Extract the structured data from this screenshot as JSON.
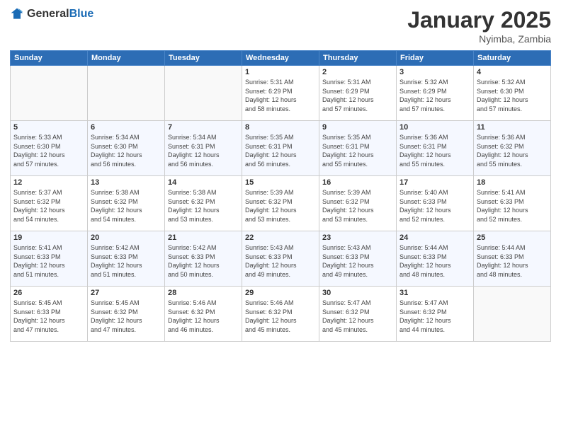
{
  "logo": {
    "general": "General",
    "blue": "Blue"
  },
  "header": {
    "title": "January 2025",
    "subtitle": "Nyimba, Zambia"
  },
  "weekdays": [
    "Sunday",
    "Monday",
    "Tuesday",
    "Wednesday",
    "Thursday",
    "Friday",
    "Saturday"
  ],
  "weeks": [
    [
      {
        "day": "",
        "info": ""
      },
      {
        "day": "",
        "info": ""
      },
      {
        "day": "",
        "info": ""
      },
      {
        "day": "1",
        "info": "Sunrise: 5:31 AM\nSunset: 6:29 PM\nDaylight: 12 hours\nand 58 minutes."
      },
      {
        "day": "2",
        "info": "Sunrise: 5:31 AM\nSunset: 6:29 PM\nDaylight: 12 hours\nand 57 minutes."
      },
      {
        "day": "3",
        "info": "Sunrise: 5:32 AM\nSunset: 6:29 PM\nDaylight: 12 hours\nand 57 minutes."
      },
      {
        "day": "4",
        "info": "Sunrise: 5:32 AM\nSunset: 6:30 PM\nDaylight: 12 hours\nand 57 minutes."
      }
    ],
    [
      {
        "day": "5",
        "info": "Sunrise: 5:33 AM\nSunset: 6:30 PM\nDaylight: 12 hours\nand 57 minutes."
      },
      {
        "day": "6",
        "info": "Sunrise: 5:34 AM\nSunset: 6:30 PM\nDaylight: 12 hours\nand 56 minutes."
      },
      {
        "day": "7",
        "info": "Sunrise: 5:34 AM\nSunset: 6:31 PM\nDaylight: 12 hours\nand 56 minutes."
      },
      {
        "day": "8",
        "info": "Sunrise: 5:35 AM\nSunset: 6:31 PM\nDaylight: 12 hours\nand 56 minutes."
      },
      {
        "day": "9",
        "info": "Sunrise: 5:35 AM\nSunset: 6:31 PM\nDaylight: 12 hours\nand 55 minutes."
      },
      {
        "day": "10",
        "info": "Sunrise: 5:36 AM\nSunset: 6:31 PM\nDaylight: 12 hours\nand 55 minutes."
      },
      {
        "day": "11",
        "info": "Sunrise: 5:36 AM\nSunset: 6:32 PM\nDaylight: 12 hours\nand 55 minutes."
      }
    ],
    [
      {
        "day": "12",
        "info": "Sunrise: 5:37 AM\nSunset: 6:32 PM\nDaylight: 12 hours\nand 54 minutes."
      },
      {
        "day": "13",
        "info": "Sunrise: 5:38 AM\nSunset: 6:32 PM\nDaylight: 12 hours\nand 54 minutes."
      },
      {
        "day": "14",
        "info": "Sunrise: 5:38 AM\nSunset: 6:32 PM\nDaylight: 12 hours\nand 53 minutes."
      },
      {
        "day": "15",
        "info": "Sunrise: 5:39 AM\nSunset: 6:32 PM\nDaylight: 12 hours\nand 53 minutes."
      },
      {
        "day": "16",
        "info": "Sunrise: 5:39 AM\nSunset: 6:32 PM\nDaylight: 12 hours\nand 53 minutes."
      },
      {
        "day": "17",
        "info": "Sunrise: 5:40 AM\nSunset: 6:33 PM\nDaylight: 12 hours\nand 52 minutes."
      },
      {
        "day": "18",
        "info": "Sunrise: 5:41 AM\nSunset: 6:33 PM\nDaylight: 12 hours\nand 52 minutes."
      }
    ],
    [
      {
        "day": "19",
        "info": "Sunrise: 5:41 AM\nSunset: 6:33 PM\nDaylight: 12 hours\nand 51 minutes."
      },
      {
        "day": "20",
        "info": "Sunrise: 5:42 AM\nSunset: 6:33 PM\nDaylight: 12 hours\nand 51 minutes."
      },
      {
        "day": "21",
        "info": "Sunrise: 5:42 AM\nSunset: 6:33 PM\nDaylight: 12 hours\nand 50 minutes."
      },
      {
        "day": "22",
        "info": "Sunrise: 5:43 AM\nSunset: 6:33 PM\nDaylight: 12 hours\nand 49 minutes."
      },
      {
        "day": "23",
        "info": "Sunrise: 5:43 AM\nSunset: 6:33 PM\nDaylight: 12 hours\nand 49 minutes."
      },
      {
        "day": "24",
        "info": "Sunrise: 5:44 AM\nSunset: 6:33 PM\nDaylight: 12 hours\nand 48 minutes."
      },
      {
        "day": "25",
        "info": "Sunrise: 5:44 AM\nSunset: 6:33 PM\nDaylight: 12 hours\nand 48 minutes."
      }
    ],
    [
      {
        "day": "26",
        "info": "Sunrise: 5:45 AM\nSunset: 6:33 PM\nDaylight: 12 hours\nand 47 minutes."
      },
      {
        "day": "27",
        "info": "Sunrise: 5:45 AM\nSunset: 6:32 PM\nDaylight: 12 hours\nand 47 minutes."
      },
      {
        "day": "28",
        "info": "Sunrise: 5:46 AM\nSunset: 6:32 PM\nDaylight: 12 hours\nand 46 minutes."
      },
      {
        "day": "29",
        "info": "Sunrise: 5:46 AM\nSunset: 6:32 PM\nDaylight: 12 hours\nand 45 minutes."
      },
      {
        "day": "30",
        "info": "Sunrise: 5:47 AM\nSunset: 6:32 PM\nDaylight: 12 hours\nand 45 minutes."
      },
      {
        "day": "31",
        "info": "Sunrise: 5:47 AM\nSunset: 6:32 PM\nDaylight: 12 hours\nand 44 minutes."
      },
      {
        "day": "",
        "info": ""
      }
    ]
  ]
}
